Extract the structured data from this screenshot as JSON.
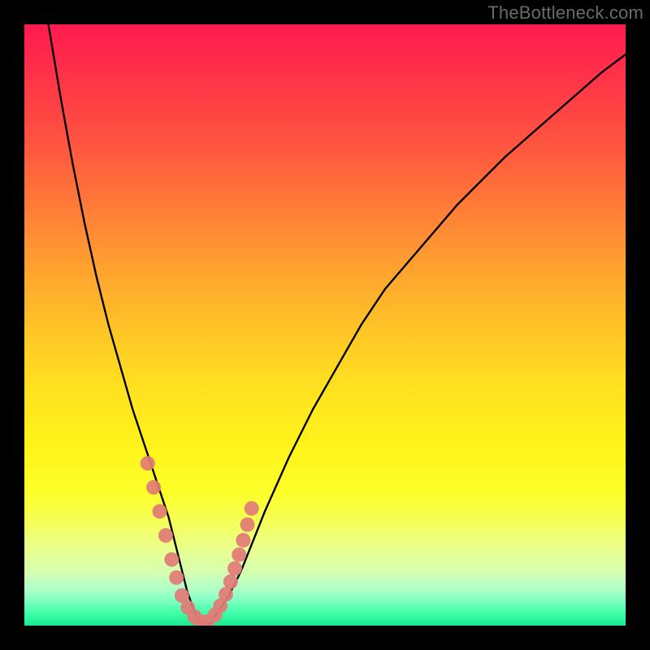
{
  "watermark": "TheBottleneck.com",
  "colors": {
    "frame": "#000000",
    "curve": "#000000",
    "marker": "#e27b76",
    "gradient_stops": [
      "#ff1a4f",
      "#ff2e4a",
      "#ff5540",
      "#ff7a38",
      "#ffa030",
      "#ffc227",
      "#ffe020",
      "#fff31a",
      "#fdff2a",
      "#f4ff5a",
      "#eaff8a",
      "#d6ffb0",
      "#aeffc8",
      "#7affc0",
      "#3effa6",
      "#18e890"
    ]
  },
  "chart_data": {
    "type": "line",
    "title": "",
    "xlabel": "",
    "ylabel": "",
    "xlim": [
      0,
      100
    ],
    "ylim": [
      0,
      100
    ],
    "series": [
      {
        "name": "bottleneck-curve",
        "x": [
          4,
          6,
          8,
          10,
          12,
          14,
          16,
          18,
          20,
          22,
          24,
          25,
          26,
          27,
          28,
          29,
          30,
          31,
          32,
          34,
          36,
          38,
          40,
          44,
          48,
          52,
          56,
          60,
          66,
          72,
          80,
          88,
          96,
          100
        ],
        "y": [
          100,
          88,
          77,
          67,
          58,
          50,
          43,
          36,
          30,
          24,
          18,
          14,
          10,
          6,
          3,
          1,
          0,
          0.5,
          2,
          5,
          9,
          14,
          19,
          28,
          36,
          43,
          50,
          56,
          63,
          70,
          78,
          85,
          92,
          95
        ]
      }
    ],
    "markers": {
      "name": "highlight-dots",
      "x": [
        20.5,
        21.5,
        22.5,
        23.5,
        24.5,
        25.3,
        26.2,
        27.2,
        28.3,
        29.3,
        30.5,
        31.7,
        32.6,
        33.5,
        34.3,
        35.0,
        35.7,
        36.4,
        37.1,
        37.8
      ],
      "y": [
        27,
        23,
        19,
        15,
        11,
        8,
        5,
        3,
        1.5,
        0.7,
        0.7,
        1.8,
        3.3,
        5.2,
        7.3,
        9.5,
        11.8,
        14.2,
        16.8,
        19.5
      ]
    }
  }
}
